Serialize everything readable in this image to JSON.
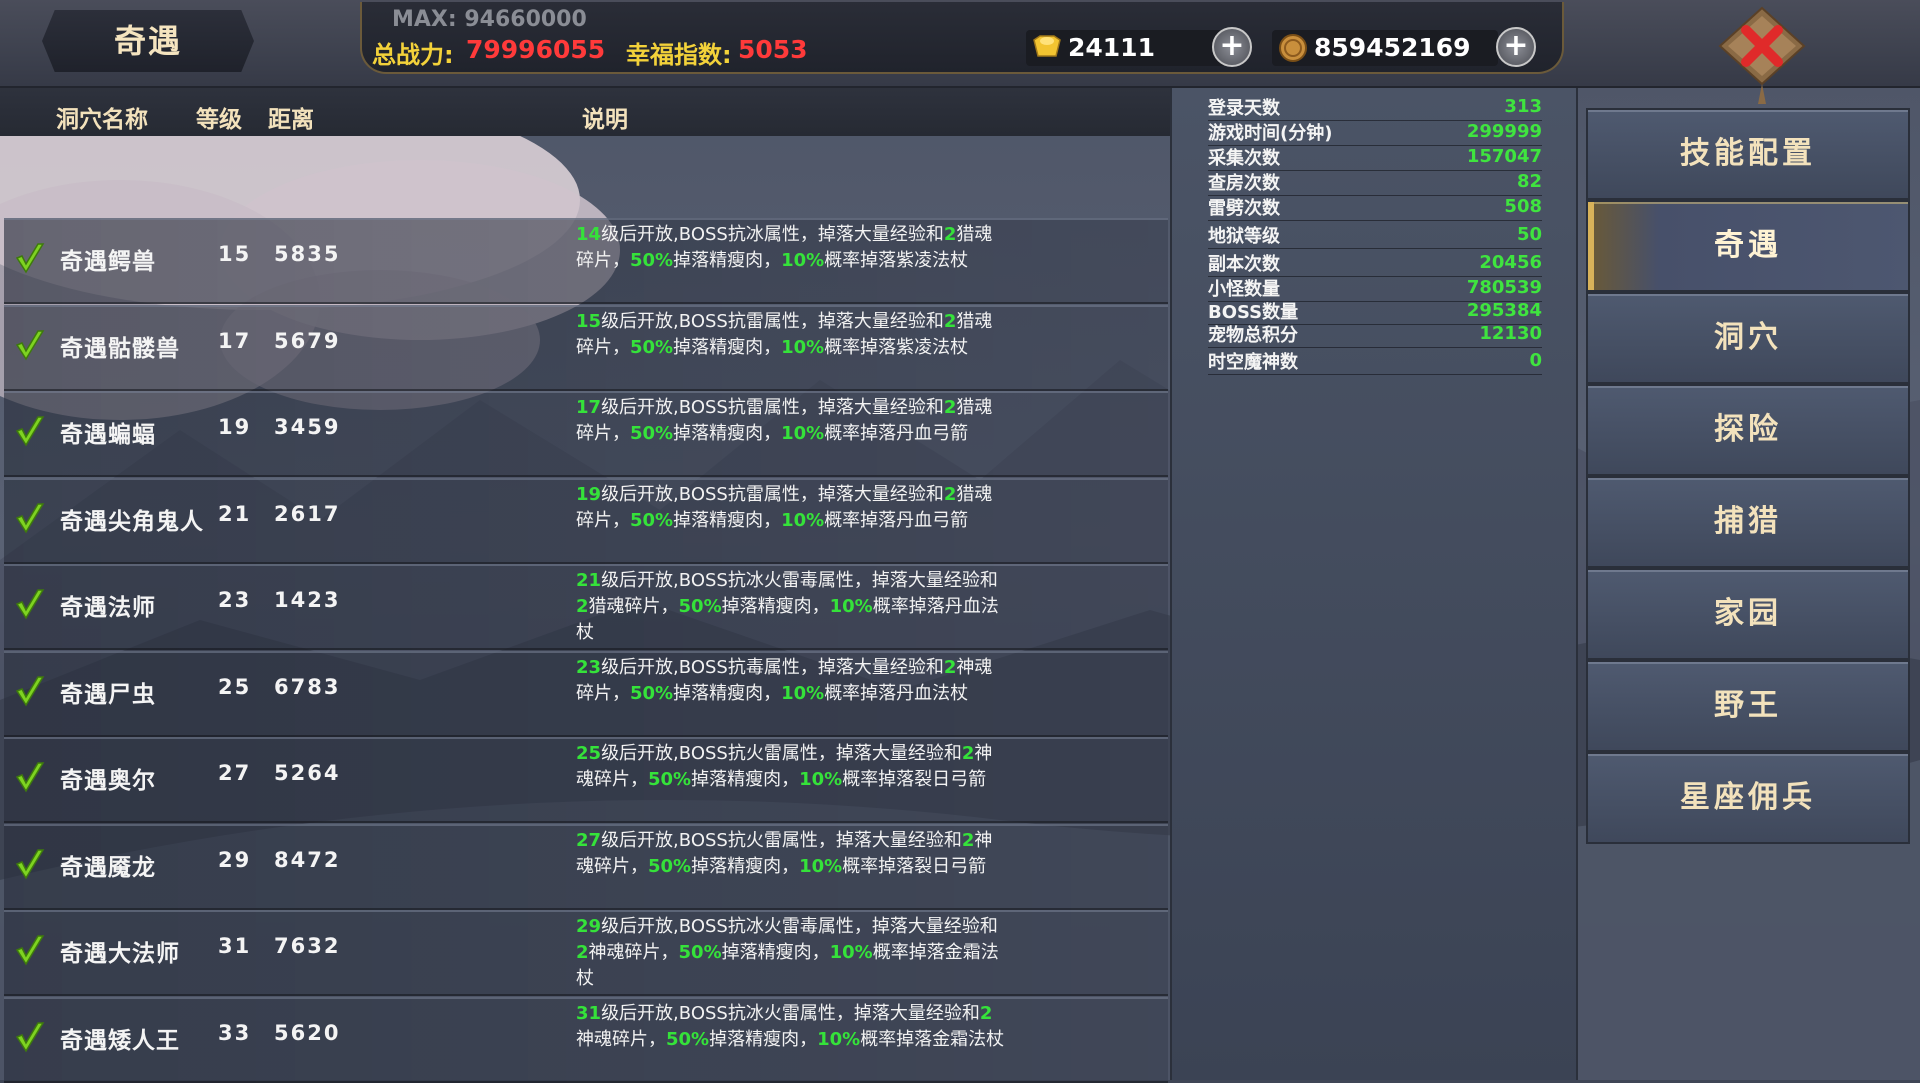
{
  "header": {
    "title": "奇遇",
    "max_power": "MAX: 94660000",
    "power_label": "总战力:",
    "power_value": "79996055",
    "happiness_label": "幸福指数:",
    "happiness_value": "5053",
    "gold_icon": "gold-ingot-icon",
    "gold_value": "24111",
    "coin_icon": "copper-coin-icon",
    "coin_value": "859452169",
    "add_icon": "plus-icon",
    "close_icon": "close-x-icon",
    "add_label": "+"
  },
  "table": {
    "headers": [
      "洞穴名称",
      "等级",
      "距离",
      "说明"
    ],
    "rows": [
      {
        "name": "奇遇鳄兽",
        "level": "15",
        "distance": "5835",
        "desc_html": "<b>14</b>级后开放,BOSS抗冰属性，掉落大量经验和<b>2</b>猎魂碎片，<b>50%</b>掉落精瘦肉，<b>10%</b>概率掉落紫凌法杖"
      },
      {
        "name": "奇遇骷髅兽",
        "level": "17",
        "distance": "5679",
        "desc_html": "<b>15</b>级后开放,BOSS抗雷属性，掉落大量经验和<b>2</b>猎魂碎片，<b>50%</b>掉落精瘦肉，<b>10%</b>概率掉落紫凌法杖"
      },
      {
        "name": "奇遇蝙蝠",
        "level": "19",
        "distance": "3459",
        "desc_html": "<b>17</b>级后开放,BOSS抗雷属性，掉落大量经验和<b>2</b>猎魂碎片，<b>50%</b>掉落精瘦肉，<b>10%</b>概率掉落丹血弓箭"
      },
      {
        "name": "奇遇尖角鬼人",
        "level": "21",
        "distance": "2617",
        "desc_html": "<b>19</b>级后开放,BOSS抗雷属性，掉落大量经验和<b>2</b>猎魂碎片，<b>50%</b>掉落精瘦肉，<b>10%</b>概率掉落丹血弓箭"
      },
      {
        "name": "奇遇法师",
        "level": "23",
        "distance": "1423",
        "desc_html": "<b>21</b>级后开放,BOSS抗冰火雷毒属性，掉落大量经验和<b>2</b>猎魂碎片，<b>50%</b>掉落精瘦肉，<b>10%</b>概率掉落丹血法杖"
      },
      {
        "name": "奇遇尸虫",
        "level": "25",
        "distance": "6783",
        "desc_html": "<b>23</b>级后开放,BOSS抗毒属性，掉落大量经验和<b>2</b>神魂碎片，<b>50%</b>掉落精瘦肉，<b>10%</b>概率掉落丹血法杖"
      },
      {
        "name": "奇遇奥尔",
        "level": "27",
        "distance": "5264",
        "desc_html": "<b>25</b>级后开放,BOSS抗火雷属性，掉落大量经验和<b>2</b>神魂碎片，<b>50%</b>掉落精瘦肉，<b>10%</b>概率掉落裂日弓箭"
      },
      {
        "name": "奇遇魇龙",
        "level": "29",
        "distance": "8472",
        "desc_html": "<b>27</b>级后开放,BOSS抗火雷属性，掉落大量经验和<b>2</b>神魂碎片，<b>50%</b>掉落精瘦肉，<b>10%</b>概率掉落裂日弓箭"
      },
      {
        "name": "奇遇大法师",
        "level": "31",
        "distance": "7632",
        "desc_html": "<b>29</b>级后开放,BOSS抗冰火雷毒属性，掉落大量经验和<b>2</b>神魂碎片，<b>50%</b>掉落精瘦肉，<b>10%</b>概率掉落金霜法杖"
      },
      {
        "name": "奇遇矮人王",
        "level": "33",
        "distance": "5620",
        "desc_html": "<b>31</b>级后开放,BOSS抗冰火雷属性，掉落大量经验和<b>2</b>神魂碎片，<b>50%</b>掉落精瘦肉，<b>10%</b>概率掉落金霜法杖"
      }
    ],
    "check_icon": "green-check-icon"
  },
  "stats": [
    {
      "label": "登录天数",
      "value": "313"
    },
    {
      "label": "游戏时间(分钟)",
      "value": "299999"
    },
    {
      "label": "采集次数",
      "value": "157047"
    },
    {
      "label": "查房次数",
      "value": "82"
    },
    {
      "label": "雷劈次数",
      "value": "508"
    },
    {
      "label": "地狱等级",
      "value": "50"
    },
    {
      "label": "副本次数",
      "value": "20456"
    },
    {
      "label": "小怪数量",
      "value": "780539"
    },
    {
      "label": "BOSS数量",
      "value": "295384"
    },
    {
      "label": "宠物总积分",
      "value": "12130"
    },
    {
      "label": "时空魔神数",
      "value": "0"
    }
  ],
  "nav": {
    "items": [
      {
        "label": "技能配置",
        "active": false
      },
      {
        "label": "奇遇",
        "active": true
      },
      {
        "label": "洞穴",
        "active": false
      },
      {
        "label": "探险",
        "active": false
      },
      {
        "label": "捕猎",
        "active": false
      },
      {
        "label": "家园",
        "active": false
      },
      {
        "label": "野王",
        "active": false
      },
      {
        "label": "星座佣兵",
        "active": false
      }
    ]
  },
  "colors": {
    "highlight_green": "#35e23a",
    "power_red": "#ff3a3a",
    "label_gold": "#f3d23a",
    "title_cream": "#f3e2bc"
  }
}
